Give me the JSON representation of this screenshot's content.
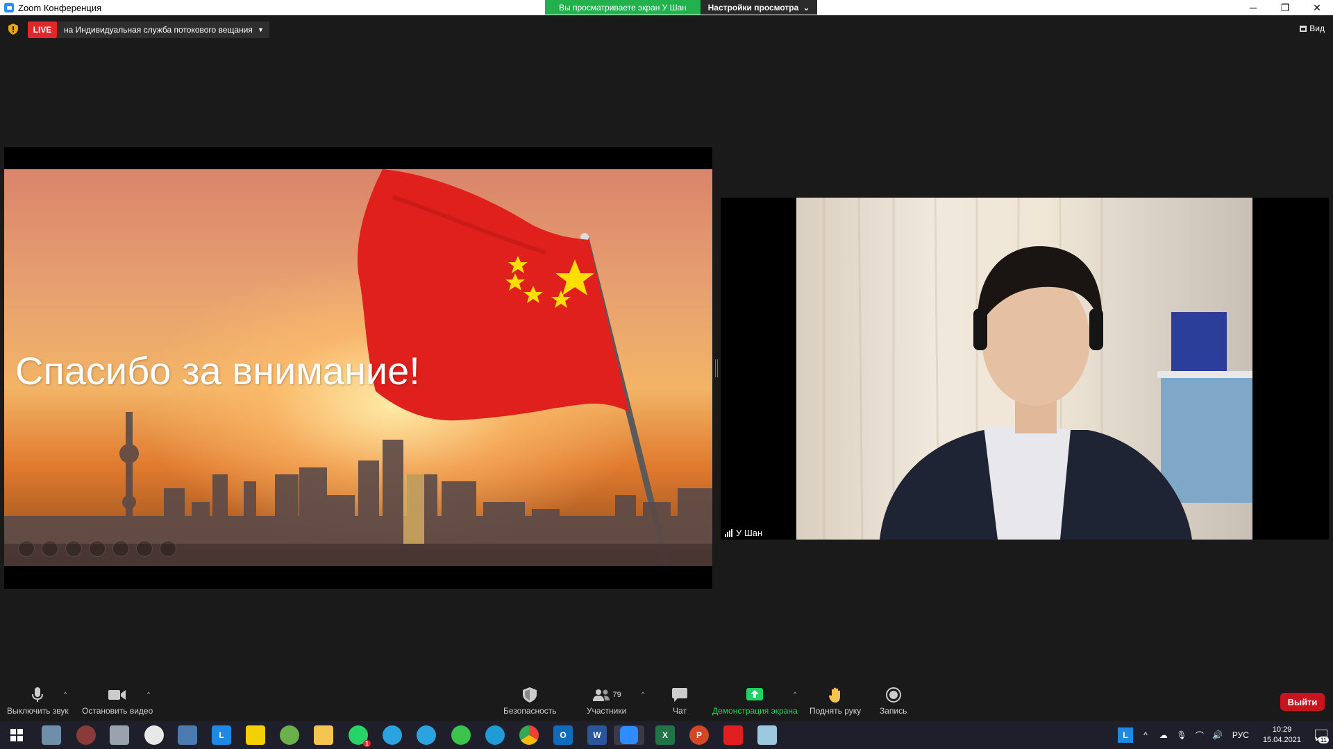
{
  "window": {
    "title": "Zoom Конференция",
    "share_banner": "Вы просматриваете экран У Шан",
    "view_options": "Настройки просмотра",
    "minimize": "─",
    "restore": "❐",
    "close": "✕"
  },
  "meeting_top": {
    "live_label": "LIVE",
    "live_target": "на Индивидуальная служба потокового вещания",
    "view_label": "Вид"
  },
  "slide": {
    "title": "Спасибо за внимание!"
  },
  "participant": {
    "name": "У Шан"
  },
  "toolbar": {
    "mute": "Выключить звук",
    "stop_video": "Остановить видео",
    "security": "Безопасность",
    "participants": "Участники",
    "participants_count": "79",
    "chat": "Чат",
    "share_screen": "Демонстрация экрана",
    "raise_hand": "Поднять руку",
    "record": "Запись",
    "leave": "Выйти"
  },
  "taskbar": {
    "lang": "РУС",
    "time": "10:29",
    "date": "15.04.2021",
    "notifications": "11",
    "whatsapp_badge": "1"
  },
  "colors": {
    "live_red": "#e02828",
    "banner_green": "#23b14d",
    "leave_red": "#c8141e",
    "flag_red": "#e0201c"
  }
}
